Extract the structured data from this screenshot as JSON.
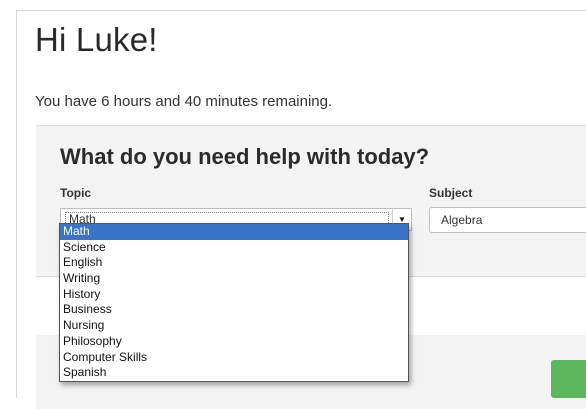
{
  "greeting": "Hi Luke!",
  "time_remaining": "You have 6 hours and 40 minutes remaining.",
  "help_form": {
    "title": "What do you need help with today?",
    "topic_label": "Topic",
    "topic_value": "Math",
    "subject_label": "Subject",
    "subject_value": "Algebra"
  },
  "topic_options": [
    "Math",
    "Science",
    "English",
    "Writing",
    "History",
    "Business",
    "Nursing",
    "Philosophy",
    "Computer Skills",
    "Spanish"
  ],
  "selected_topic_index": 0,
  "colors": {
    "selected_option": "#3a74c9",
    "action_button": "#5cb85c"
  },
  "icons": {
    "topic_dropdown_arrow": "chevron-down-icon"
  }
}
